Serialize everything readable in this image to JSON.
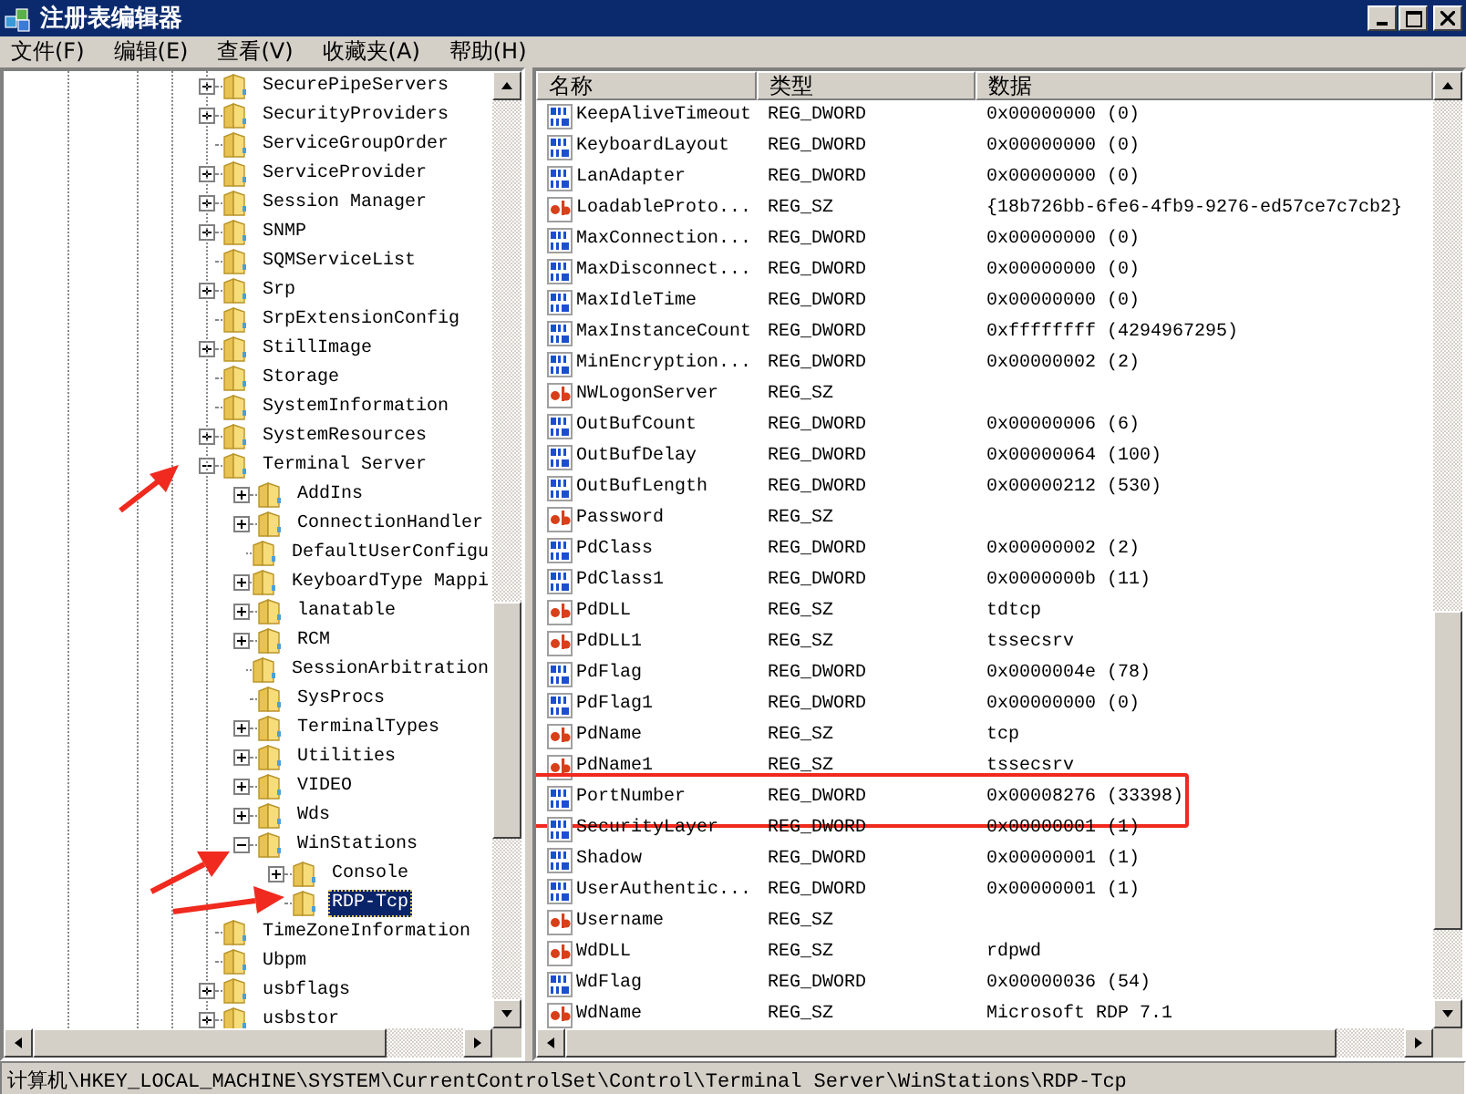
{
  "window": {
    "title": "注册表编辑器"
  },
  "menu": [
    "文件(F)",
    "编辑(E)",
    "查看(V)",
    "收藏夹(A)",
    "帮助(H)"
  ],
  "tree": [
    {
      "label": "SecurePipeServers",
      "kind": "collapsed",
      "selected": false
    },
    {
      "label": "SecurityProviders",
      "kind": "collapsed",
      "selected": false
    },
    {
      "label": "ServiceGroupOrder",
      "kind": "leaf",
      "selected": false
    },
    {
      "label": "ServiceProvider",
      "kind": "collapsed",
      "selected": false
    },
    {
      "label": "Session Manager",
      "kind": "collapsed",
      "selected": false
    },
    {
      "label": "SNMP",
      "kind": "collapsed",
      "selected": false
    },
    {
      "label": "SQMServiceList",
      "kind": "leaf",
      "selected": false
    },
    {
      "label": "Srp",
      "kind": "collapsed",
      "selected": false
    },
    {
      "label": "SrpExtensionConfig",
      "kind": "leaf",
      "selected": false
    },
    {
      "label": "StillImage",
      "kind": "collapsed",
      "selected": false
    },
    {
      "label": "Storage",
      "kind": "leaf",
      "selected": false
    },
    {
      "label": "SystemInformation",
      "kind": "leaf",
      "selected": false
    },
    {
      "label": "SystemResources",
      "kind": "collapsed",
      "selected": false
    },
    {
      "label": "Terminal Server",
      "kind": "expanded",
      "selected": false,
      "children": [
        {
          "label": "AddIns",
          "kind": "collapsed",
          "selected": false
        },
        {
          "label": "ConnectionHandler",
          "kind": "collapsed",
          "selected": false
        },
        {
          "label": "DefaultUserConfigu",
          "kind": "leaf",
          "selected": false
        },
        {
          "label": "KeyboardType Mappi",
          "kind": "collapsed",
          "selected": false
        },
        {
          "label": "lanatable",
          "kind": "collapsed",
          "selected": false
        },
        {
          "label": "RCM",
          "kind": "collapsed",
          "selected": false
        },
        {
          "label": "SessionArbitration",
          "kind": "leaf",
          "selected": false
        },
        {
          "label": "SysProcs",
          "kind": "leaf",
          "selected": false
        },
        {
          "label": "TerminalTypes",
          "kind": "collapsed",
          "selected": false
        },
        {
          "label": "Utilities",
          "kind": "collapsed",
          "selected": false
        },
        {
          "label": "VIDEO",
          "kind": "collapsed",
          "selected": false
        },
        {
          "label": "Wds",
          "kind": "collapsed",
          "selected": false
        },
        {
          "label": "WinStations",
          "kind": "expanded",
          "selected": false,
          "children": [
            {
              "label": "Console",
              "kind": "collapsed",
              "selected": false
            },
            {
              "label": "RDP-Tcp",
              "kind": "leaf",
              "selected": true
            }
          ]
        }
      ]
    },
    {
      "label": "TimeZoneInformation",
      "kind": "leaf",
      "selected": false
    },
    {
      "label": "Ubpm",
      "kind": "leaf",
      "selected": false
    },
    {
      "label": "usbflags",
      "kind": "collapsed",
      "selected": false
    },
    {
      "label": "usbstor",
      "kind": "collapsed",
      "selected": false
    }
  ],
  "table": {
    "columns": [
      "名称",
      "类型",
      "数据"
    ],
    "rows": [
      {
        "kind": "dword",
        "name": "KeepAliveTimeout",
        "type": "REG_DWORD",
        "data": "0x00000000 (0)",
        "highlighted": false
      },
      {
        "kind": "dword",
        "name": "KeyboardLayout",
        "type": "REG_DWORD",
        "data": "0x00000000 (0)",
        "highlighted": false
      },
      {
        "kind": "dword",
        "name": "LanAdapter",
        "type": "REG_DWORD",
        "data": "0x00000000 (0)",
        "highlighted": false
      },
      {
        "kind": "sz",
        "name": "LoadableProto...",
        "type": "REG_SZ",
        "data": "{18b726bb-6fe6-4fb9-9276-ed57ce7c7cb2}",
        "highlighted": false
      },
      {
        "kind": "dword",
        "name": "MaxConnection...",
        "type": "REG_DWORD",
        "data": "0x00000000 (0)",
        "highlighted": false
      },
      {
        "kind": "dword",
        "name": "MaxDisconnect...",
        "type": "REG_DWORD",
        "data": "0x00000000 (0)",
        "highlighted": false
      },
      {
        "kind": "dword",
        "name": "MaxIdleTime",
        "type": "REG_DWORD",
        "data": "0x00000000 (0)",
        "highlighted": false
      },
      {
        "kind": "dword",
        "name": "MaxInstanceCount",
        "type": "REG_DWORD",
        "data": "0xffffffff (4294967295)",
        "highlighted": false
      },
      {
        "kind": "dword",
        "name": "MinEncryption...",
        "type": "REG_DWORD",
        "data": "0x00000002 (2)",
        "highlighted": false
      },
      {
        "kind": "sz",
        "name": "NWLogonServer",
        "type": "REG_SZ",
        "data": "",
        "highlighted": false
      },
      {
        "kind": "dword",
        "name": "OutBufCount",
        "type": "REG_DWORD",
        "data": "0x00000006 (6)",
        "highlighted": false
      },
      {
        "kind": "dword",
        "name": "OutBufDelay",
        "type": "REG_DWORD",
        "data": "0x00000064 (100)",
        "highlighted": false
      },
      {
        "kind": "dword",
        "name": "OutBufLength",
        "type": "REG_DWORD",
        "data": "0x00000212 (530)",
        "highlighted": false
      },
      {
        "kind": "sz",
        "name": "Password",
        "type": "REG_SZ",
        "data": "",
        "highlighted": false
      },
      {
        "kind": "dword",
        "name": "PdClass",
        "type": "REG_DWORD",
        "data": "0x00000002 (2)",
        "highlighted": false
      },
      {
        "kind": "dword",
        "name": "PdClass1",
        "type": "REG_DWORD",
        "data": "0x0000000b (11)",
        "highlighted": false
      },
      {
        "kind": "sz",
        "name": "PdDLL",
        "type": "REG_SZ",
        "data": "tdtcp",
        "highlighted": false
      },
      {
        "kind": "sz",
        "name": "PdDLL1",
        "type": "REG_SZ",
        "data": "tssecsrv",
        "highlighted": false
      },
      {
        "kind": "dword",
        "name": "PdFlag",
        "type": "REG_DWORD",
        "data": "0x0000004e (78)",
        "highlighted": false
      },
      {
        "kind": "dword",
        "name": "PdFlag1",
        "type": "REG_DWORD",
        "data": "0x00000000 (0)",
        "highlighted": false
      },
      {
        "kind": "sz",
        "name": "PdName",
        "type": "REG_SZ",
        "data": "tcp",
        "highlighted": false
      },
      {
        "kind": "sz",
        "name": "PdName1",
        "type": "REG_SZ",
        "data": "tssecsrv",
        "highlighted": false
      },
      {
        "kind": "dword",
        "name": "PortNumber",
        "type": "REG_DWORD",
        "data": "0x00008276 (33398)",
        "highlighted": true
      },
      {
        "kind": "dword",
        "name": "SecurityLayer",
        "type": "REG_DWORD",
        "data": "0x00000001 (1)",
        "highlighted": false
      },
      {
        "kind": "dword",
        "name": "Shadow",
        "type": "REG_DWORD",
        "data": "0x00000001 (1)",
        "highlighted": false
      },
      {
        "kind": "dword",
        "name": "UserAuthentic...",
        "type": "REG_DWORD",
        "data": "0x00000001 (1)",
        "highlighted": false
      },
      {
        "kind": "sz",
        "name": "Username",
        "type": "REG_SZ",
        "data": "",
        "highlighted": false
      },
      {
        "kind": "sz",
        "name": "WdDLL",
        "type": "REG_SZ",
        "data": "rdpwd",
        "highlighted": false
      },
      {
        "kind": "dword",
        "name": "WdFlag",
        "type": "REG_DWORD",
        "data": "0x00000036 (54)",
        "highlighted": false
      },
      {
        "kind": "sz",
        "name": "WdName",
        "type": "REG_SZ",
        "data": "Microsoft RDP 7.1",
        "highlighted": false
      }
    ]
  },
  "status_bar": "计算机\\HKEY_LOCAL_MACHINE\\SYSTEM\\CurrentControlSet\\Control\\Terminal Server\\WinStations\\RDP-Tcp"
}
